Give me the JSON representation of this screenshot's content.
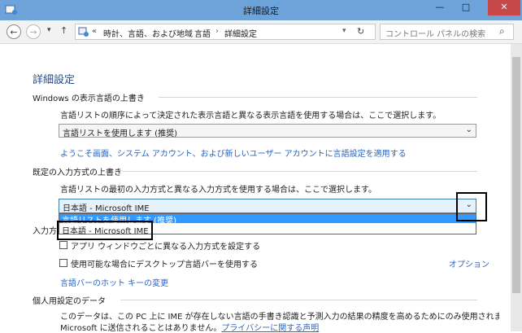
{
  "window": {
    "title": "詳細設定",
    "minimize": "—",
    "maximize": "□",
    "close": "✕"
  },
  "address": {
    "back": "←",
    "forward": "→",
    "dropdown": "▾",
    "up": "↑",
    "chevron": "«",
    "breadcrumb": [
      "時計、言語、および地域",
      "言語",
      "詳細設定"
    ],
    "sep": "›",
    "refresh": "↻",
    "search_placeholder": "コントロール パネルの検索",
    "search_icon": "⌕"
  },
  "page": {
    "title": "詳細設定",
    "sec1": {
      "heading": "Windows の表示言語の上書き",
      "desc": "言語リストの順序によって決定された表示言語と異なる表示言語を使用する場合は、ここで選択します。",
      "select_value": "言語リストを使用します (推奨)",
      "link": "ようこそ画面、システム アカウント、および新しいユーザー アカウントに言語設定を適用する"
    },
    "sec2": {
      "heading": "既定の入力方式の上書き",
      "desc": "言語リストの最初の入力方式と異なる入力方式を使用する場合は、ここで選択します。",
      "select_value": "日本語 - Microsoft IME",
      "dropdown_options": [
        "言語リストを使用します (推奨)",
        "日本語 - Microsoft IME"
      ],
      "selected_index": 0
    },
    "sec3": {
      "heading_partial": "入力方",
      "cb1": "アプリ ウィンドウごとに異なる入力方式を設定する",
      "cb2": "使用可能な場合にデスクトップ言語バーを使用する",
      "options": "オプション",
      "link": "言語バーのホット キーの変更"
    },
    "sec4": {
      "heading": "個人用設定のデータ",
      "desc1": "このデータは、この PC 上に IME が存在しない言語の手書き認識と予測入力の結果の精度を高めるためにのみ使用されます。情報が",
      "desc2_pre": "Microsoft に送信されることはありません。",
      "desc2_link": "プライバシーに関する声明"
    }
  },
  "colors": {
    "titlebar": "#6ea3da",
    "link": "#2a64c4",
    "heading": "#1e4c96",
    "highlight": "#3399ff"
  }
}
